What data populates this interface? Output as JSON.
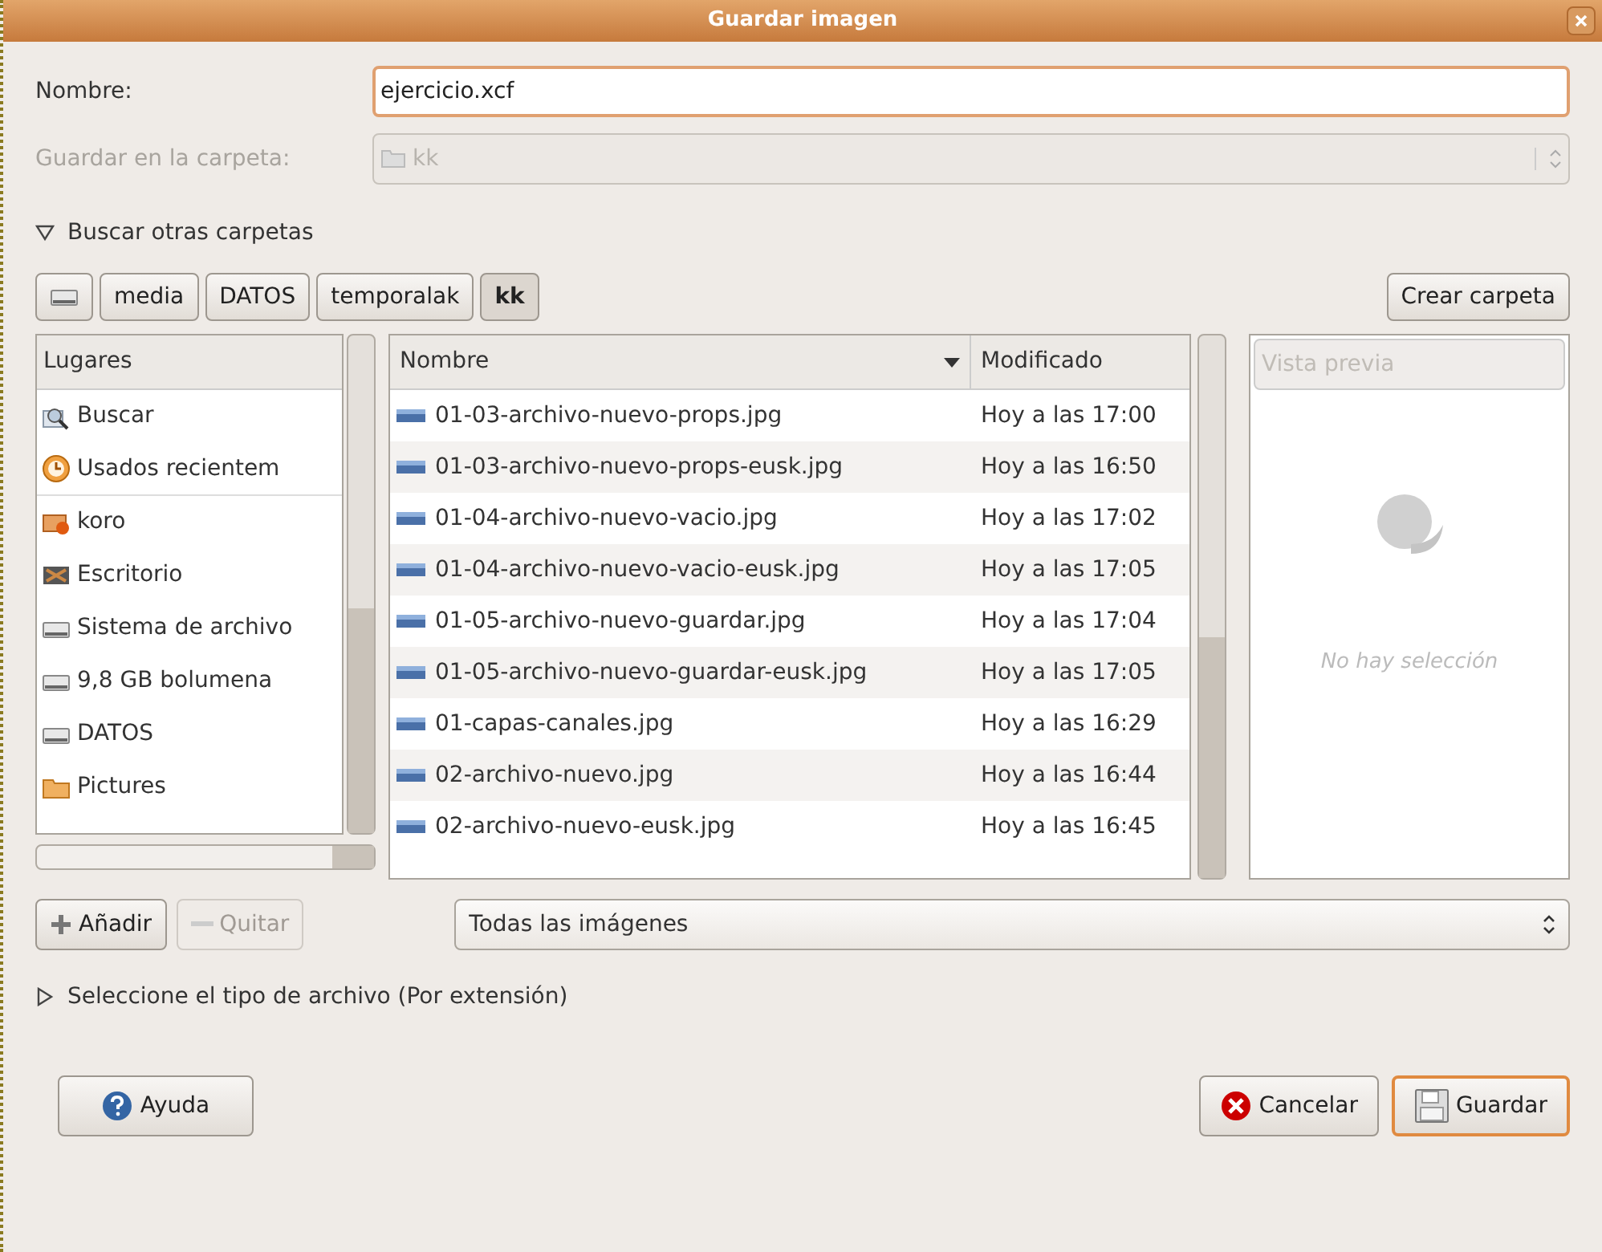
{
  "window": {
    "title": "Guardar imagen"
  },
  "name_field": {
    "label": "Nombre:",
    "value": "ejercicio.xcf"
  },
  "folder_field": {
    "label": "Guardar en la carpeta:",
    "value": "kk",
    "disabled": true
  },
  "browse_expander": {
    "label": "Buscar otras carpetas",
    "expanded": true
  },
  "path_bar": [
    {
      "label": "media",
      "selected": false
    },
    {
      "label": "DATOS",
      "selected": false
    },
    {
      "label": "temporalak",
      "selected": false
    },
    {
      "label": "kk",
      "selected": true
    }
  ],
  "create_folder_button": "Crear carpeta",
  "places": {
    "header": "Lugares",
    "items": [
      {
        "label": "Buscar",
        "kind": "search"
      },
      {
        "label": "Usados recientem",
        "kind": "recent"
      },
      {
        "label": "koro",
        "kind": "home"
      },
      {
        "label": "Escritorio",
        "kind": "desktop"
      },
      {
        "label": "Sistema de archivo",
        "kind": "drive"
      },
      {
        "label": "9,8 GB bolumena",
        "kind": "drive"
      },
      {
        "label": "DATOS",
        "kind": "drive"
      },
      {
        "label": "Pictures",
        "kind": "folder"
      }
    ]
  },
  "files": {
    "columns": [
      "Nombre",
      "Modificado"
    ],
    "rows": [
      {
        "name": "01-03-archivo-nuevo-props.jpg",
        "modified": "Hoy a las 17:00"
      },
      {
        "name": "01-03-archivo-nuevo-props-eusk.jpg",
        "modified": "Hoy a las 16:50"
      },
      {
        "name": "01-04-archivo-nuevo-vacio.jpg",
        "modified": "Hoy a las 17:02"
      },
      {
        "name": "01-04-archivo-nuevo-vacio-eusk.jpg",
        "modified": "Hoy a las 17:05"
      },
      {
        "name": "01-05-archivo-nuevo-guardar.jpg",
        "modified": "Hoy a las 17:04"
      },
      {
        "name": "01-05-archivo-nuevo-guardar-eusk.jpg",
        "modified": "Hoy a las 17:05"
      },
      {
        "name": "01-capas-canales.jpg",
        "modified": "Hoy a las 16:29"
      },
      {
        "name": "02-archivo-nuevo.jpg",
        "modified": "Hoy a las 16:44"
      },
      {
        "name": "02-archivo-nuevo-eusk.jpg",
        "modified": "Hoy a las 16:45"
      }
    ]
  },
  "preview": {
    "header": "Vista previa",
    "message": "No hay selección"
  },
  "add_button": {
    "label": "Añadir",
    "disabled": false
  },
  "remove_button": {
    "label": "Quitar",
    "disabled": true
  },
  "filter": {
    "value": "Todas las imágenes"
  },
  "type_expander": {
    "label": "Seleccione el tipo de archivo (Por extensión)",
    "expanded": false
  },
  "buttons": [
    {
      "label": "Ayuda",
      "kind": "help"
    },
    {
      "label": "Cancelar",
      "kind": "cancel"
    },
    {
      "label": "Guardar",
      "kind": "save"
    }
  ]
}
